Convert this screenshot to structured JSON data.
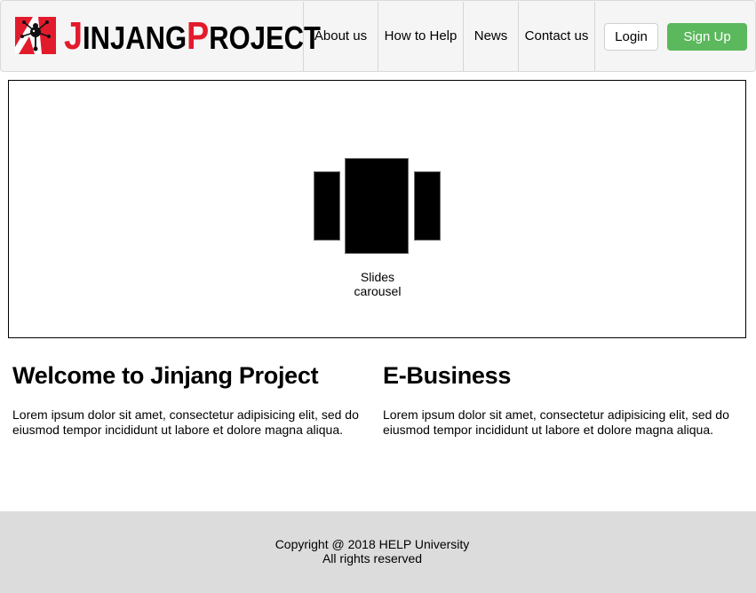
{
  "brand": {
    "logo_icon": "jinjang-project-logo-icon",
    "logo_text": "JINJANG PROJECT",
    "logo_parts": {
      "j": "J",
      "injang": "INJANG",
      "p": "P",
      "roject": "ROJECT"
    },
    "accent_color": "#e21b2c"
  },
  "nav": {
    "items": [
      {
        "label": "About us"
      },
      {
        "label": "How to Help"
      },
      {
        "label": "News"
      },
      {
        "label": "Contact us"
      }
    ]
  },
  "auth": {
    "login_label": "Login",
    "signup_label": "Sign Up",
    "signup_color": "#5cb85c"
  },
  "carousel": {
    "icon": "slides-carousel-icon",
    "caption_line1": "Slides",
    "caption_line2": "carousel"
  },
  "sections": [
    {
      "heading": "Welcome to Jinjang Project",
      "body": "Lorem ipsum dolor sit amet, consectetur adipisicing elit, sed do eiusmod tempor incididunt ut labore et dolore magna aliqua."
    },
    {
      "heading": "E-Business",
      "body": "Lorem ipsum dolor sit amet, consectetur adipisicing elit, sed do eiusmod tempor incididunt ut labore et dolore magna aliqua."
    }
  ],
  "footer": {
    "copyright": "Copyright @ 2018 HELP University",
    "rights": "All rights reserved"
  }
}
